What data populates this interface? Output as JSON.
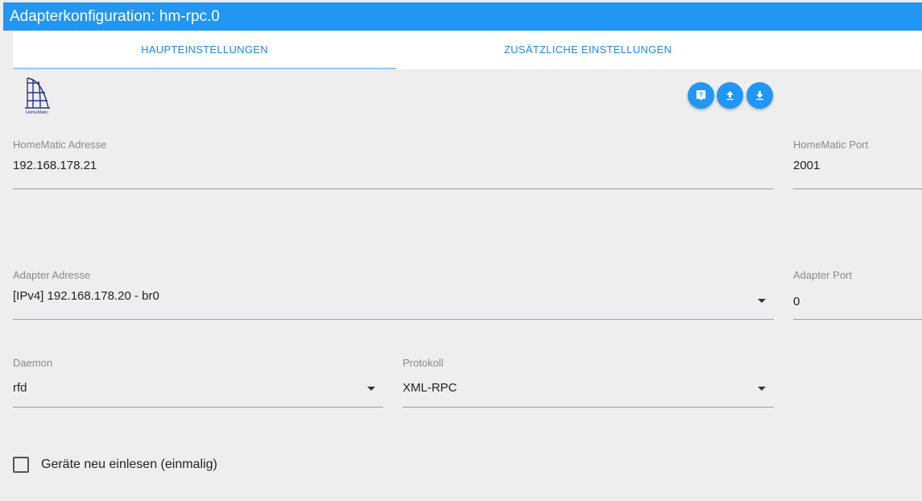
{
  "window": {
    "title": "Adapterkonfiguration: hm-rpc.0"
  },
  "tabs": [
    {
      "label": "HAUPTEINSTELLUNGEN",
      "active": true
    },
    {
      "label": "ZUSÄTZLICHE EINSTELLUNGEN",
      "active": false
    }
  ],
  "logo": {
    "text": "HomeMatic"
  },
  "actions": {
    "help_icon": "help-icon",
    "upload_icon": "upload-icon",
    "download_icon": "download-icon"
  },
  "fields": {
    "homematic_address": {
      "label": "HomeMatic Adresse",
      "value": "192.168.178.21"
    },
    "homematic_port": {
      "label": "HomeMatic Port",
      "value": "2001"
    },
    "adapter_address": {
      "label": "Adapter Adresse",
      "value": "[IPv4] 192.168.178.20 - br0"
    },
    "adapter_port": {
      "label": "Adapter Port",
      "value": "0"
    },
    "daemon": {
      "label": "Daemon",
      "value": "rfd"
    },
    "protocol": {
      "label": "Protokoll",
      "value": "XML-RPC"
    }
  },
  "checkbox": {
    "label": "Geräte neu einlesen (einmalig)",
    "checked": false
  },
  "colors": {
    "accent": "#2196f3",
    "background": "#eeeeee",
    "tab_text": "#1e88e5"
  }
}
